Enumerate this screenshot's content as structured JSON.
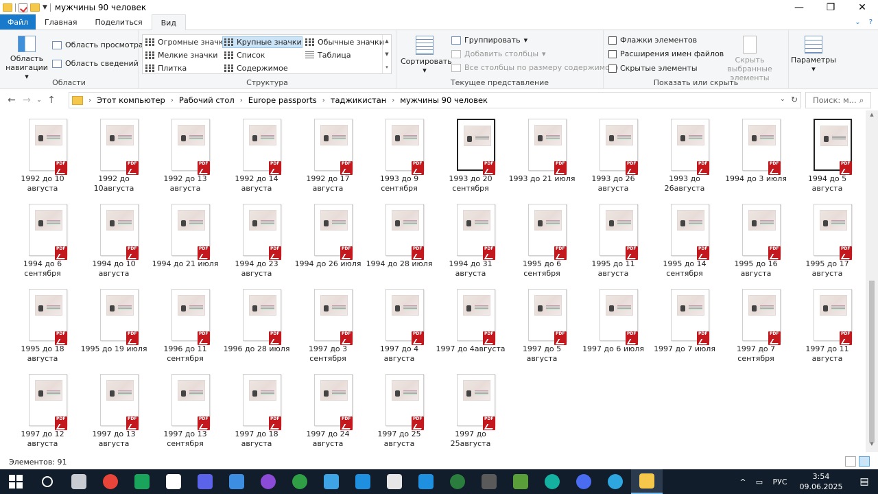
{
  "window": {
    "title": "мужчины 90 человек",
    "controls": [
      "—",
      "❐",
      "✕"
    ]
  },
  "tabs": [
    {
      "label": "Файл",
      "kind": "file"
    },
    {
      "label": "Главная"
    },
    {
      "label": "Поделиться"
    },
    {
      "label": "Вид",
      "active": true
    }
  ],
  "ribbon": {
    "areas": {
      "title": "Области",
      "nav_pane": "Область навигации",
      "preview_pane": "Область просмотра",
      "details_pane": "Область сведений"
    },
    "structure": {
      "title": "Структура",
      "options": [
        "Огромные значки",
        "Крупные значки",
        "Обычные значки",
        "Мелкие значки",
        "Список",
        "Таблица",
        "Плитка",
        "Содержимое"
      ],
      "selected": "Крупные значки"
    },
    "current_view": {
      "title": "Текущее представление",
      "sort": "Сортировать",
      "group": "Группировать",
      "add_columns": "Добавить столбцы",
      "fit_columns": "Все столбцы по размеру содержимого"
    },
    "show_hide": {
      "title": "Показать или скрыть",
      "item_checkboxes": "Флажки элементов",
      "file_extensions": "Расширения имен файлов",
      "hidden_items": "Скрытые элементы",
      "hide_selected": "Скрыть выбранные элементы"
    },
    "options": {
      "label": "Параметры"
    }
  },
  "address": {
    "path": [
      "Этот компьютер",
      "Рабочий стол",
      "Europe passports",
      "таджикистан",
      "мужчины 90 человек"
    ],
    "search_placeholder": "Поиск: м..."
  },
  "files": [
    {
      "line1": "1992 до 10",
      "line2": "августа"
    },
    {
      "line1": "1992 до",
      "line2": "10августа"
    },
    {
      "line1": "1992 до 13",
      "line2": "августа"
    },
    {
      "line1": "1992 до 14",
      "line2": "августа"
    },
    {
      "line1": "1992 до 17",
      "line2": "августа"
    },
    {
      "line1": "1993 до 9",
      "line2": "сентября"
    },
    {
      "line1": "1993 до 20",
      "line2": "сентября",
      "dark": true
    },
    {
      "line1": "1993 до 21 июля",
      "line2": ""
    },
    {
      "line1": "1993 до 26",
      "line2": "августа"
    },
    {
      "line1": "1993 до",
      "line2": "26августа"
    },
    {
      "line1": "1994 до 3 июля",
      "line2": ""
    },
    {
      "line1": "1994 до 5 августа",
      "line2": "",
      "dark": true
    },
    {
      "line1": "1994 до 6",
      "line2": "сентября"
    },
    {
      "line1": "1994 до 10",
      "line2": "августа"
    },
    {
      "line1": "1994 до 21 июля",
      "line2": ""
    },
    {
      "line1": "1994 до 23",
      "line2": "августа"
    },
    {
      "line1": "1994 до 26 июля",
      "line2": ""
    },
    {
      "line1": "1994 до 28 июля",
      "line2": ""
    },
    {
      "line1": "1994 до 31",
      "line2": "августа"
    },
    {
      "line1": "1995 до 6",
      "line2": "сентября"
    },
    {
      "line1": "1995 до 11",
      "line2": "августа"
    },
    {
      "line1": "1995 до 14",
      "line2": "сентября"
    },
    {
      "line1": "1995 до 16",
      "line2": "августа"
    },
    {
      "line1": "1995 до 17",
      "line2": "августа"
    },
    {
      "line1": "1995 до 18",
      "line2": "августа"
    },
    {
      "line1": "1995 до 19 июля",
      "line2": ""
    },
    {
      "line1": "1996 до 11",
      "line2": "сентября"
    },
    {
      "line1": "1996 до 28 июля",
      "line2": ""
    },
    {
      "line1": "1997 до 3",
      "line2": "сентября"
    },
    {
      "line1": "1997 до 4 августа",
      "line2": ""
    },
    {
      "line1": "1997 до 4августа",
      "line2": ""
    },
    {
      "line1": "1997 до 5 августа",
      "line2": ""
    },
    {
      "line1": "1997 до 6 июля",
      "line2": ""
    },
    {
      "line1": "1997 до 7 июля",
      "line2": ""
    },
    {
      "line1": "1997 до 7",
      "line2": "сентября"
    },
    {
      "line1": "1997 до 11",
      "line2": "августа"
    },
    {
      "line1": "1997 до 12",
      "line2": "августа"
    },
    {
      "line1": "1997 до 13",
      "line2": "августа"
    },
    {
      "line1": "1997 до 13",
      "line2": "сентября"
    },
    {
      "line1": "1997 до 18",
      "line2": "августа"
    },
    {
      "line1": "1997 до 24",
      "line2": "августа"
    },
    {
      "line1": "1997 до 25",
      "line2": "августа"
    },
    {
      "line1": "1997 до",
      "line2": "25августа"
    }
  ],
  "pdf_badge": "PDF",
  "status": {
    "count_label": "Элементов: 91"
  },
  "taskbar": {
    "icons": [
      "start-icon",
      "search-icon",
      "computer-icon",
      "chrome-icon",
      "flag-icon",
      "settings-icon",
      "app-g-icon",
      "pencil-icon",
      "orb-icon",
      "utorrent-icon",
      "photos-icon",
      "sync-icon",
      "dotted-box-icon",
      "shield-icon",
      "spiral-icon",
      "person-icon",
      "lock-icon",
      "globe-icon",
      "bubble-icon",
      "telegram-icon",
      "explorer-icon"
    ],
    "colors": [
      "#2d7ad6",
      "#ffffff",
      "#c8ccd2",
      "#e8443a",
      "#1aa35a",
      "#ffffff",
      "#5b63e8",
      "#3d8ee0",
      "#8b4bd6",
      "#2f9e44",
      "#3fa4e6",
      "#1f8fe0",
      "#e6e6e6",
      "#1f8fe0",
      "#2b7d3e",
      "#5a5a5a",
      "#5a9e3a",
      "#14b0a0",
      "#4a6cf0",
      "#2ea6e0",
      "#f5c84c"
    ],
    "language": "РУС",
    "time": "3:54",
    "date": "09.06.2025"
  }
}
